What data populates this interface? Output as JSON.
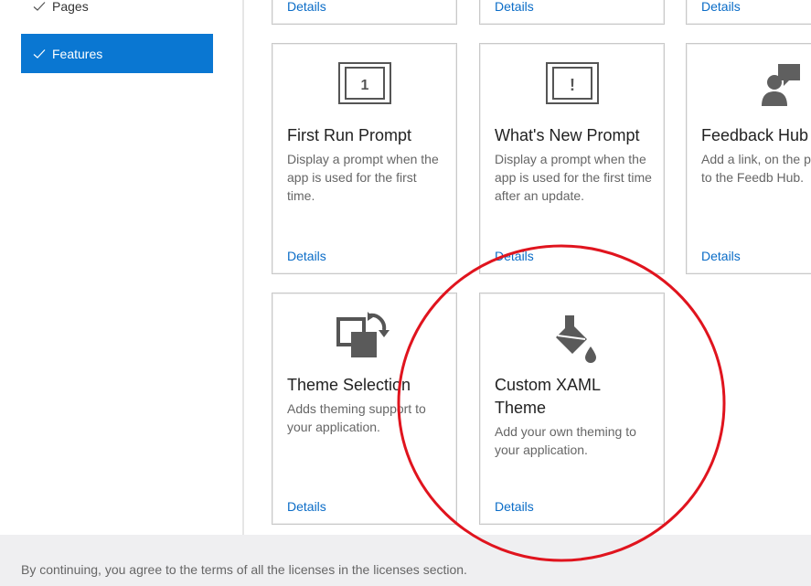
{
  "sidebar": {
    "items": [
      {
        "label": "Pages",
        "selected": false
      },
      {
        "label": "Features",
        "selected": true
      }
    ]
  },
  "cards": [
    {
      "title": "",
      "description": "",
      "details": "Details"
    },
    {
      "title": "",
      "description": "",
      "details": "Details"
    },
    {
      "title": "",
      "description": "",
      "details": "Details"
    },
    {
      "title": "First Run Prompt",
      "description": "Display a prompt when the app is used for the first time.",
      "details": "Details",
      "icon": "first-run-prompt-icon",
      "icon_glyph": "1"
    },
    {
      "title": "What's New Prompt",
      "description": "Display a prompt when the app is used for the first time after an update.",
      "details": "Details",
      "icon": "whats-new-prompt-icon",
      "icon_glyph": "!"
    },
    {
      "title": "Feedback Hub",
      "description": "Add a link, on the page, to the Feedb Hub.",
      "details": "Details",
      "icon": "feedback-hub-icon"
    },
    {
      "title": "Theme Selection",
      "description": "Adds theming support to your application.",
      "details": "Details",
      "icon": "theme-selection-icon"
    },
    {
      "title": "Custom XAML Theme",
      "description": "Add your own theming to your application.",
      "details": "Details",
      "icon": "paint-bucket-icon"
    }
  ],
  "footer": {
    "text": "By continuing, you agree to the terms of all the licenses in the licenses section."
  },
  "colors": {
    "accent": "#0a77d2",
    "link": "#0a6cc7",
    "annotation": "#e0141e"
  }
}
